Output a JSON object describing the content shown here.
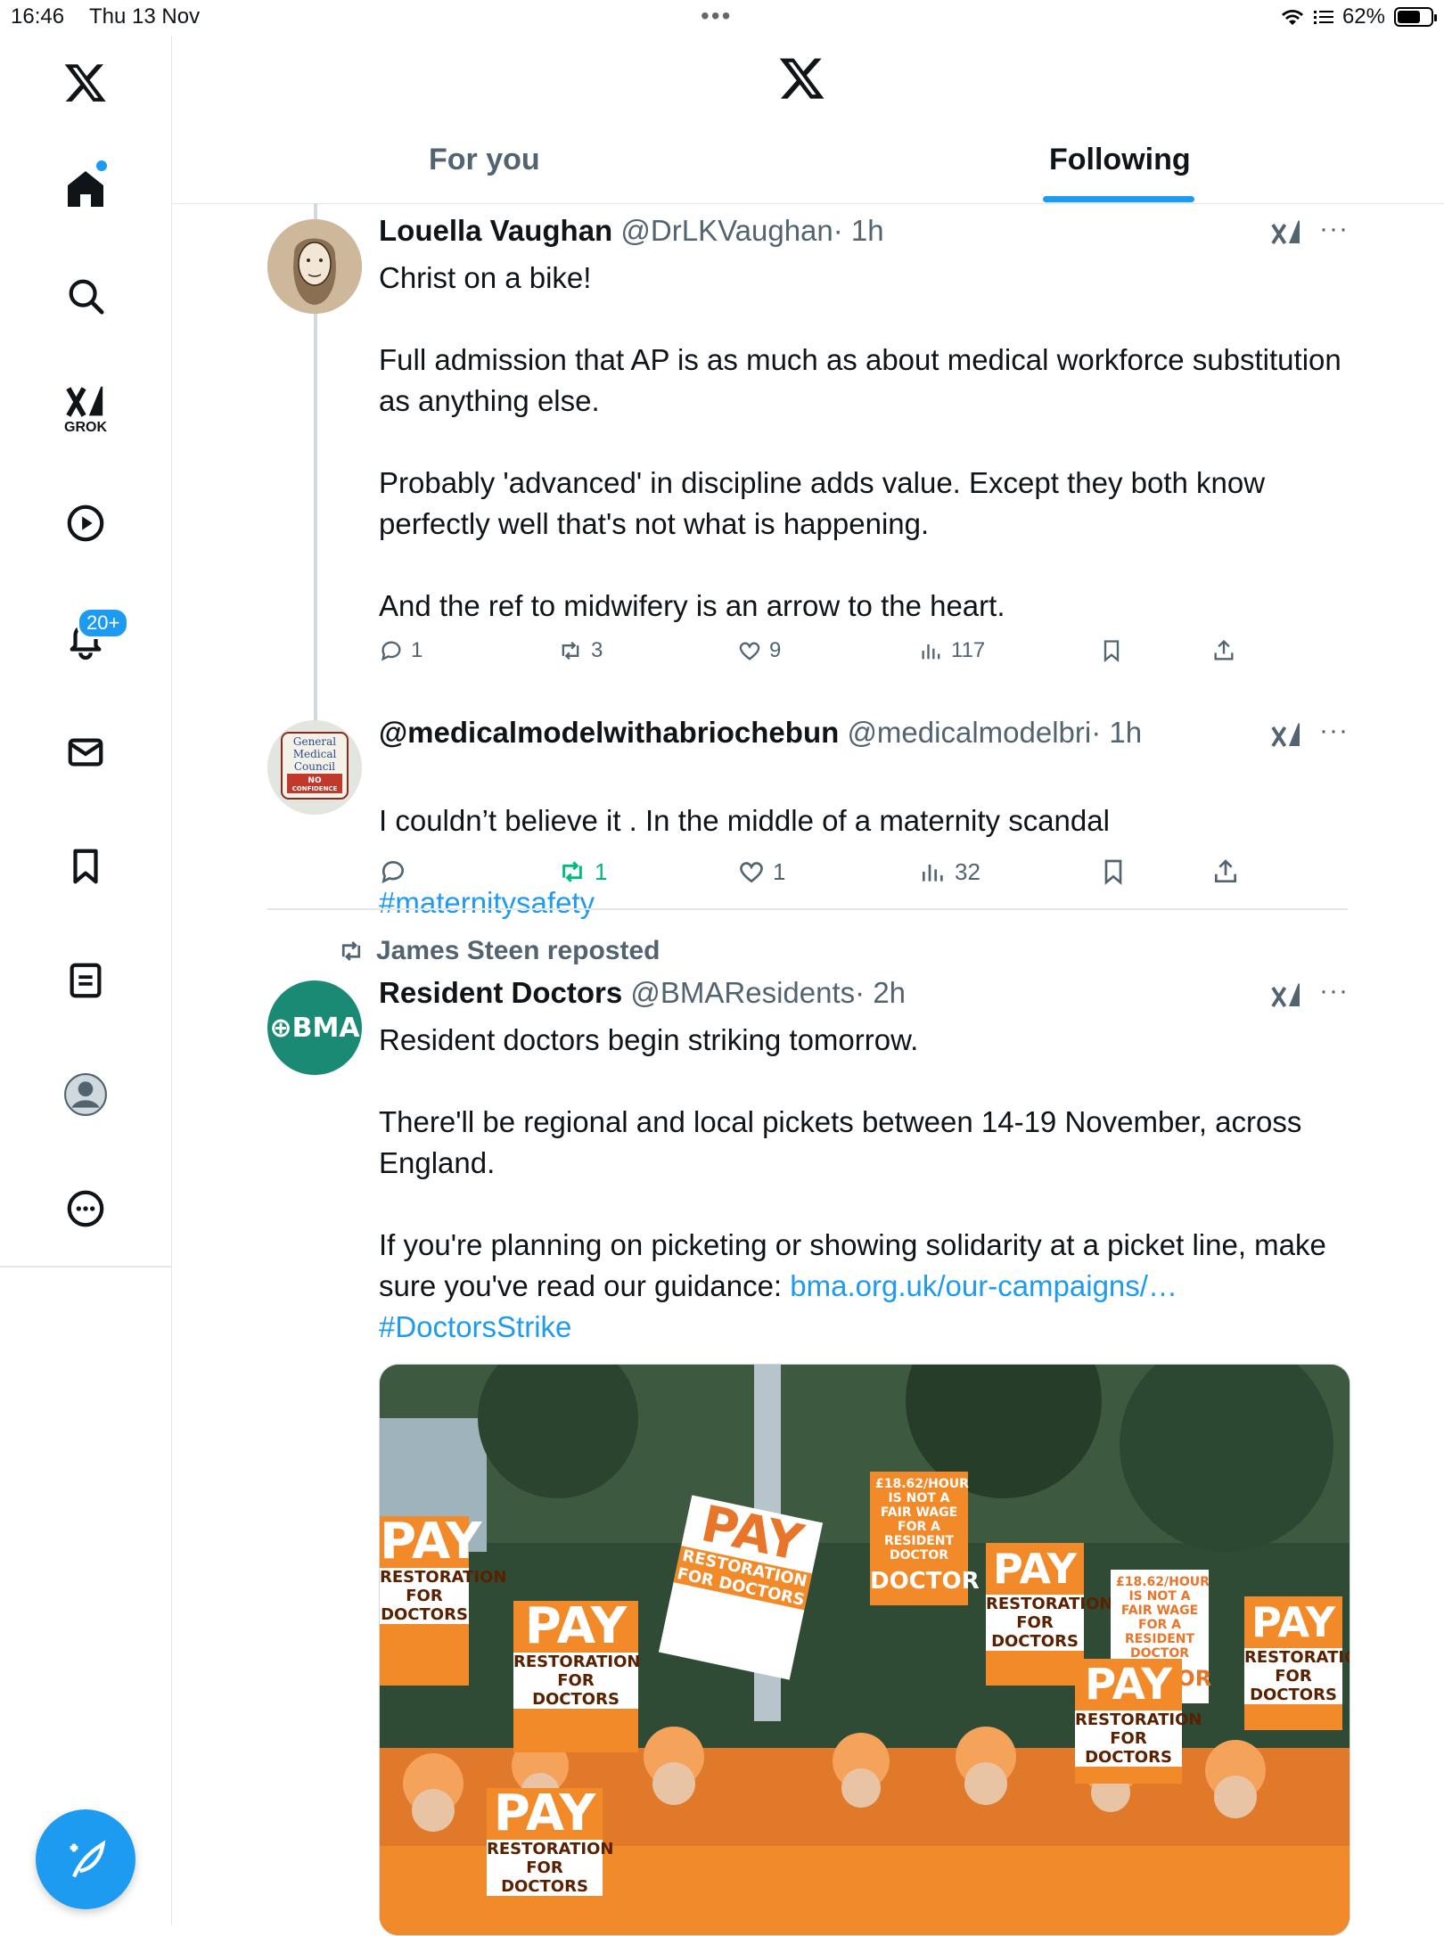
{
  "status_bar": {
    "time": "16:46",
    "date": "Thu 13 Nov",
    "battery": "62%"
  },
  "sidebar": {
    "grok_label": "GROK",
    "notifications_badge": "20+"
  },
  "tabs": {
    "for_you": "For you",
    "following": "Following"
  },
  "tweets": [
    {
      "name": "Louella Vaughan",
      "handle": "@DrLKVaughan",
      "time": "· 1h",
      "text": "Christ on a bike!\n\nFull admission that AP is as much as about medical workforce substitution as anything else.\n\nProbably 'advanced' in discipline adds value. Except they both know perfectly well that's not what is happening.\n\nAnd the ref to midwifery is an arrow to the heart.",
      "replies": "1",
      "reposts": "3",
      "likes": "9",
      "views": "117"
    },
    {
      "name": "@medicalmodelwithabriochebun",
      "handle": "@medicalmodelbri",
      "time": "· 1h",
      "text": "I couldn’t believe it . In the middle of a maternity scandal",
      "hashtag": "#maternitysafety",
      "avatar_text": [
        "General",
        "Medical",
        "Council",
        "NO",
        "CONFIDENCE"
      ],
      "replies": "",
      "reposts": "1",
      "likes": "1",
      "views": "32"
    },
    {
      "reposted_by": "James Steen reposted",
      "name": "Resident Doctors",
      "handle": "@BMAResidents",
      "time": "· 2h",
      "avatar_text": "BMA",
      "text_1": "Resident doctors begin striking tomorrow.\n\nThere'll be regional and local pickets between 14-19 November, across England.\n\nIf you're planning on picketing or showing solidarity at a picket line, make sure you've read our guidance: ",
      "link": "bma.org.uk/our-campaigns/…",
      "hashtag": "#DoctorsStrike",
      "placards": {
        "pay": "PAY",
        "sub": "RESTORATION FOR DOCTORS",
        "sign": "£18.62/HOUR IS NOT A FAIR WAGE FOR A RESIDENT DOCTOR",
        "sign_short": "DOCTOR",
        "brand": "BMA"
      }
    }
  ],
  "colors": {
    "accent": "#1d9bf0",
    "repost_green": "#00ba7c",
    "bma_green": "#1a8a75",
    "placard_orange": "#f28a2a"
  }
}
